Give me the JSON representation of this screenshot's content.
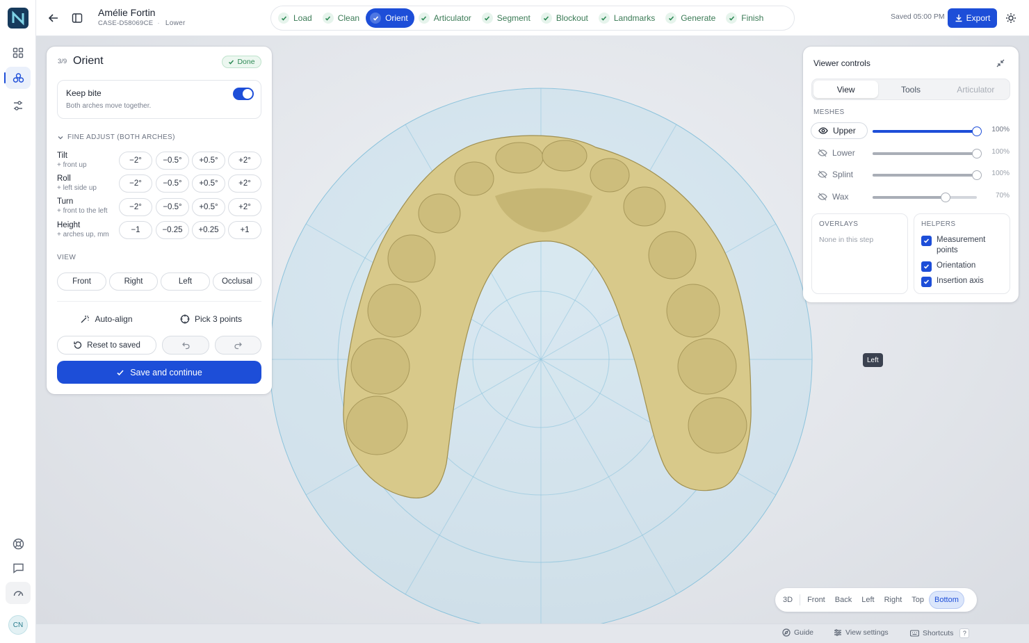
{
  "header": {
    "patient_name": "Amélie Fortin",
    "case_id": "CASE-D58069CE",
    "arch": "Lower",
    "saved_status": "Saved 05:00 PM",
    "export_label": "Export"
  },
  "steps": [
    {
      "label": "Load",
      "state": "done"
    },
    {
      "label": "Clean",
      "state": "done"
    },
    {
      "label": "Orient",
      "state": "active"
    },
    {
      "label": "Articulator",
      "state": "done"
    },
    {
      "label": "Segment",
      "state": "done"
    },
    {
      "label": "Blockout",
      "state": "done"
    },
    {
      "label": "Landmarks",
      "state": "done"
    },
    {
      "label": "Generate",
      "state": "done"
    },
    {
      "label": "Finish",
      "state": "done"
    }
  ],
  "rail": {
    "avatar_initials": "CN",
    "items": [
      "grid-icon",
      "teeth-icon",
      "sliders-icon"
    ],
    "bottom_items": [
      "help-icon",
      "chat-icon",
      "gauge-icon"
    ]
  },
  "orient_panel": {
    "step_counter": "3/9",
    "title": "Orient",
    "done_badge": "Done",
    "keep_bite": {
      "label": "Keep bite",
      "description": "Both arches move together.",
      "enabled": true
    },
    "fine_adjust_heading": "FINE ADJUST (BOTH ARCHES)",
    "adjust_rows": [
      {
        "label": "Tilt",
        "hint": "+ front up",
        "buttons": [
          "−2°",
          "−0.5°",
          "+0.5°",
          "+2°"
        ]
      },
      {
        "label": "Roll",
        "hint": "+ left side up",
        "buttons": [
          "−2°",
          "−0.5°",
          "+0.5°",
          "+2°"
        ]
      },
      {
        "label": "Turn",
        "hint": "+ front to the left",
        "buttons": [
          "−2°",
          "−0.5°",
          "+0.5°",
          "+2°"
        ]
      },
      {
        "label": "Height",
        "hint": "+ arches up, mm",
        "buttons": [
          "−1",
          "−0.25",
          "+0.25",
          "+1"
        ]
      }
    ],
    "view_heading": "VIEW",
    "view_buttons": [
      "Front",
      "Right",
      "Left",
      "Occlusal"
    ],
    "auto_align_label": "Auto-align",
    "pick_points_label": "Pick 3 points",
    "reset_label": "Reset to saved",
    "save_label": "Save and continue"
  },
  "viewer_controls": {
    "title": "Viewer controls",
    "tabs": [
      {
        "label": "View",
        "state": "active"
      },
      {
        "label": "Tools",
        "state": "normal"
      },
      {
        "label": "Articulator",
        "state": "disabled"
      }
    ],
    "meshes_heading": "MESHES",
    "meshes": [
      {
        "name": "Upper",
        "visible": true,
        "opacity": 100,
        "opacity_label": "100%"
      },
      {
        "name": "Lower",
        "visible": false,
        "opacity": 100,
        "opacity_label": "100%"
      },
      {
        "name": "Splint",
        "visible": false,
        "opacity": 100,
        "opacity_label": "100%"
      },
      {
        "name": "Wax",
        "visible": false,
        "opacity": 70,
        "opacity_label": "70%"
      }
    ],
    "overlays_heading": "OVERLAYS",
    "overlays_note": "None in this step",
    "helpers_heading": "HELPERS",
    "helpers": [
      {
        "label": "Measurement points",
        "checked": true
      },
      {
        "label": "Orientation",
        "checked": true
      },
      {
        "label": "Insertion axis",
        "checked": true
      }
    ]
  },
  "viewport": {
    "tooltip": "Left",
    "camera_views": [
      {
        "label": "3D",
        "state": "normal"
      },
      {
        "label": "Front",
        "state": "normal"
      },
      {
        "label": "Back",
        "state": "normal"
      },
      {
        "label": "Left",
        "state": "normal"
      },
      {
        "label": "Right",
        "state": "normal"
      },
      {
        "label": "Top",
        "state": "normal"
      },
      {
        "label": "Bottom",
        "state": "active"
      }
    ],
    "model_color": "#d8c98a",
    "grid_color": "#8cc3dc"
  },
  "statusbar": {
    "guide_label": "Guide",
    "view_settings_label": "View settings",
    "shortcuts_label": "Shortcuts",
    "shortcuts_key": "?"
  },
  "colors": {
    "accent": "#1d4ed8",
    "success": "#2d8a55"
  }
}
